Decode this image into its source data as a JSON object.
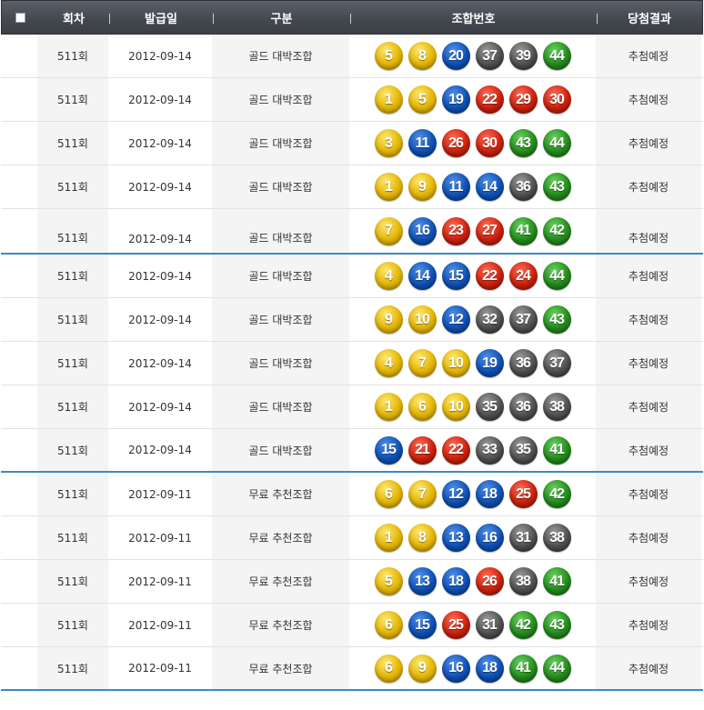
{
  "header": {
    "round": "회차",
    "issue_date": "발급일",
    "category": "구분",
    "numbers": "조합번호",
    "result": "당첨결과"
  },
  "rows": [
    {
      "round": "511회",
      "date": "2012-09-14",
      "type": "골드 대박조합",
      "numbers": [
        5,
        8,
        20,
        37,
        39,
        44
      ],
      "result": "추첨예정"
    },
    {
      "round": "511회",
      "date": "2012-09-14",
      "type": "골드 대박조합",
      "numbers": [
        1,
        5,
        19,
        22,
        29,
        30
      ],
      "result": "추첨예정"
    },
    {
      "round": "511회",
      "date": "2012-09-14",
      "type": "골드 대박조합",
      "numbers": [
        3,
        11,
        26,
        30,
        43,
        44
      ],
      "result": "추첨예정"
    },
    {
      "round": "511회",
      "date": "2012-09-14",
      "type": "골드 대박조합",
      "numbers": [
        1,
        9,
        11,
        14,
        36,
        43
      ],
      "result": "추첨예정"
    },
    {
      "round": "511회",
      "date": "2012-09-14",
      "type": "골드 대박조합",
      "numbers": [
        7,
        16,
        23,
        27,
        41,
        42
      ],
      "result": "추첨예정"
    },
    {
      "round": "511회",
      "date": "2012-09-14",
      "type": "골드 대박조합",
      "numbers": [
        4,
        14,
        15,
        22,
        24,
        44
      ],
      "result": "추첨예정"
    },
    {
      "round": "511회",
      "date": "2012-09-14",
      "type": "골드 대박조합",
      "numbers": [
        9,
        10,
        12,
        32,
        37,
        43
      ],
      "result": "추첨예정"
    },
    {
      "round": "511회",
      "date": "2012-09-14",
      "type": "골드 대박조합",
      "numbers": [
        4,
        7,
        10,
        19,
        36,
        37
      ],
      "result": "추첨예정"
    },
    {
      "round": "511회",
      "date": "2012-09-14",
      "type": "골드 대박조합",
      "numbers": [
        1,
        6,
        10,
        35,
        36,
        38
      ],
      "result": "추첨예정"
    },
    {
      "round": "511회",
      "date": "2012-09-14",
      "type": "골드 대박조합",
      "numbers": [
        15,
        21,
        22,
        33,
        35,
        41
      ],
      "result": "추첨예정"
    },
    {
      "round": "511회",
      "date": "2012-09-11",
      "type": "무료 추천조합",
      "numbers": [
        6,
        7,
        12,
        18,
        25,
        42
      ],
      "result": "추첨예정"
    },
    {
      "round": "511회",
      "date": "2012-09-11",
      "type": "무료 추천조합",
      "numbers": [
        1,
        8,
        13,
        16,
        31,
        38
      ],
      "result": "추첨예정"
    },
    {
      "round": "511회",
      "date": "2012-09-11",
      "type": "무료 추천조합",
      "numbers": [
        5,
        13,
        18,
        26,
        38,
        41
      ],
      "result": "추첨예정"
    },
    {
      "round": "511회",
      "date": "2012-09-11",
      "type": "무료 추천조합",
      "numbers": [
        6,
        15,
        25,
        31,
        42,
        43
      ],
      "result": "추첨예정"
    },
    {
      "round": "511회",
      "date": "2012-09-11",
      "type": "무료 추천조합",
      "numbers": [
        6,
        9,
        16,
        18,
        41,
        44
      ],
      "result": "추첨예정"
    }
  ],
  "ball_colors": {
    "1-10": "#e2b400",
    "11-20": "#0e4fb3",
    "21-30": "#c9200c",
    "31-40": "#4f4f4f",
    "41-45": "#238a1c"
  },
  "group_divider_color": "#3a8bc4"
}
